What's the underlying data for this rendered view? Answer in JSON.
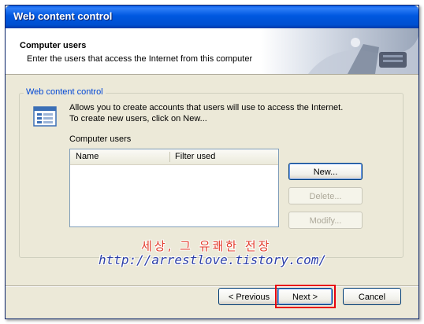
{
  "window": {
    "title": "Web content control"
  },
  "header": {
    "title": "Computer users",
    "subtitle": "Enter the users that access the Internet from this computer"
  },
  "group": {
    "label": "Web content control",
    "description": "Allows you to create accounts that users will use to access the Internet. To create new users, click on New...",
    "list_label": "Computer users",
    "columns": [
      "Name",
      "Filter used"
    ],
    "rows": []
  },
  "side_buttons": {
    "new": "New...",
    "delete": "Delete...",
    "modify": "Modify..."
  },
  "footer": {
    "previous": "< Previous",
    "next": "Next >",
    "cancel": "Cancel"
  },
  "watermark": {
    "korean": "세상, 그 유쾌한 전장",
    "url": "http://arrestlove.tistory.com/"
  },
  "colors": {
    "titlebar": "#0058e0",
    "group_label": "#0046d5",
    "highlight": "#e8000c"
  }
}
